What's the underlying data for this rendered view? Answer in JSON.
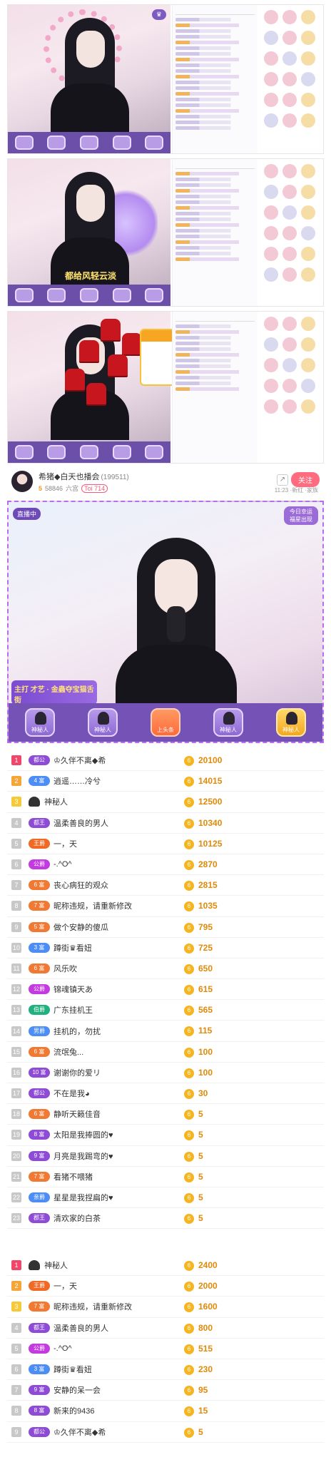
{
  "channel": {
    "name": "希猪◆白天也播会",
    "room_id": "(199511)",
    "level": "5",
    "fans": "58846",
    "fans_label": "六宫",
    "fan_tag": "Toi 714",
    "follow_label": "关注",
    "share_icon": "share-icon",
    "stats_small": "11:23 ·新红 ·家族"
  },
  "main_video": {
    "overlay_text": "直播中",
    "lucky_label": "今日幸运 福星出现",
    "promo_text": "主打 才艺 · 金蟲夺宝猫舌街",
    "seats": [
      {
        "label": "神秘人",
        "style": "purple"
      },
      {
        "label": "神秘人",
        "style": "purple"
      },
      {
        "label": "上头条",
        "style": "orange"
      },
      {
        "label": "神秘人",
        "style": "purple"
      },
      {
        "label": "神秘人",
        "style": "gold"
      }
    ]
  },
  "shot2": {
    "caption": "都给风轻云淡"
  },
  "rank_list_1": [
    {
      "rank": "1",
      "badge": "都公",
      "badge_color": "#8e4bd6",
      "name": "♔久伴不离◆希",
      "score": "20100"
    },
    {
      "rank": "2",
      "badge": "4 富",
      "badge_color": "#4c8df6",
      "name": "逍遥……冷兮",
      "score": "14015"
    },
    {
      "rank": "3",
      "badge": "",
      "badge_color": "",
      "name": "神秘人",
      "score": "12500",
      "mystery": true
    },
    {
      "rank": "4",
      "badge": "都王",
      "badge_color": "#8e4bd6",
      "name": "温柔善良的男人",
      "score": "10340"
    },
    {
      "rank": "5",
      "badge": "王爵",
      "badge_color": "#f06a25",
      "name": "一，天",
      "score": "10125"
    },
    {
      "rank": "6",
      "badge": "公爵",
      "badge_color": "#c33ae0",
      "name": "-.^O^",
      "score": "2870"
    },
    {
      "rank": "7",
      "badge": "6 富",
      "badge_color": "#f07a33",
      "name": "丧心病狂的观众",
      "score": "2815"
    },
    {
      "rank": "8",
      "badge": "7 富",
      "badge_color": "#f07a33",
      "name": "昵称违规，请重新修改",
      "score": "1035"
    },
    {
      "rank": "9",
      "badge": "5 富",
      "badge_color": "#f07a33",
      "name": "做个安静的傻瓜",
      "score": "795"
    },
    {
      "rank": "10",
      "badge": "3 富",
      "badge_color": "#4c8df6",
      "name": "蹲街♛看妞",
      "score": "725"
    },
    {
      "rank": "11",
      "badge": "6 富",
      "badge_color": "#f07a33",
      "name": "风乐吹",
      "score": "650"
    },
    {
      "rank": "12",
      "badge": "公爵",
      "badge_color": "#c33ae0",
      "name": "锦魂镇天あ",
      "score": "615"
    },
    {
      "rank": "13",
      "badge": "伯爵",
      "badge_color": "#21b07e",
      "name": "广东挂机王",
      "score": "565"
    },
    {
      "rank": "14",
      "badge": "男爵",
      "badge_color": "#4c8df6",
      "name": "挂机的，勿扰",
      "score": "115"
    },
    {
      "rank": "15",
      "badge": "6 富",
      "badge_color": "#f07a33",
      "name": "流氓兔...",
      "score": "100"
    },
    {
      "rank": "16",
      "badge": "10 富",
      "badge_color": "#8e4bd6",
      "name": "谢谢你的爱リ",
      "score": "100"
    },
    {
      "rank": "17",
      "badge": "都公",
      "badge_color": "#8e4bd6",
      "name": "不在是我◕",
      "score": "30"
    },
    {
      "rank": "18",
      "badge": "6 富",
      "badge_color": "#f07a33",
      "name": "静听天籁佳音",
      "score": "5"
    },
    {
      "rank": "19",
      "badge": "8 富",
      "badge_color": "#8e4bd6",
      "name": "太阳是我捧圆的♥",
      "score": "5"
    },
    {
      "rank": "20",
      "badge": "9 富",
      "badge_color": "#8e4bd6",
      "name": "月亮是我踢弯的♥",
      "score": "5"
    },
    {
      "rank": "21",
      "badge": "7 富",
      "badge_color": "#f07a33",
      "name": "看猪不喂猪",
      "score": "5"
    },
    {
      "rank": "22",
      "badge": "亲爵",
      "badge_color": "#4c8df6",
      "name": "星星是我捏扁的♥",
      "score": "5"
    },
    {
      "rank": "23",
      "badge": "郡王",
      "badge_color": "#8e4bd6",
      "name": "清欢家的白茶",
      "score": "5"
    }
  ],
  "rank_list_2": [
    {
      "rank": "1",
      "badge": "",
      "badge_color": "",
      "name": "神秘人",
      "score": "2400",
      "mystery": true
    },
    {
      "rank": "2",
      "badge": "王爵",
      "badge_color": "#f06a25",
      "name": "一，天",
      "score": "2000"
    },
    {
      "rank": "3",
      "badge": "7 富",
      "badge_color": "#f07a33",
      "name": "昵称违规，请重新修改",
      "score": "1600"
    },
    {
      "rank": "4",
      "badge": "都王",
      "badge_color": "#8e4bd6",
      "name": "温柔善良的男人",
      "score": "800"
    },
    {
      "rank": "5",
      "badge": "公爵",
      "badge_color": "#c33ae0",
      "name": "-.^O^",
      "score": "515"
    },
    {
      "rank": "6",
      "badge": "3 富",
      "badge_color": "#4c8df6",
      "name": "蹲街♛看妞",
      "score": "230"
    },
    {
      "rank": "7",
      "badge": "9 富",
      "badge_color": "#8e4bd6",
      "name": "安静的呆一会",
      "score": "95"
    },
    {
      "rank": "8",
      "badge": "8 富",
      "badge_color": "#8e4bd6",
      "name": "新来的9436",
      "score": "15"
    },
    {
      "rank": "9",
      "badge": "都公",
      "badge_color": "#8e4bd6",
      "name": "♔久伴不离◆希",
      "score": "5"
    }
  ]
}
